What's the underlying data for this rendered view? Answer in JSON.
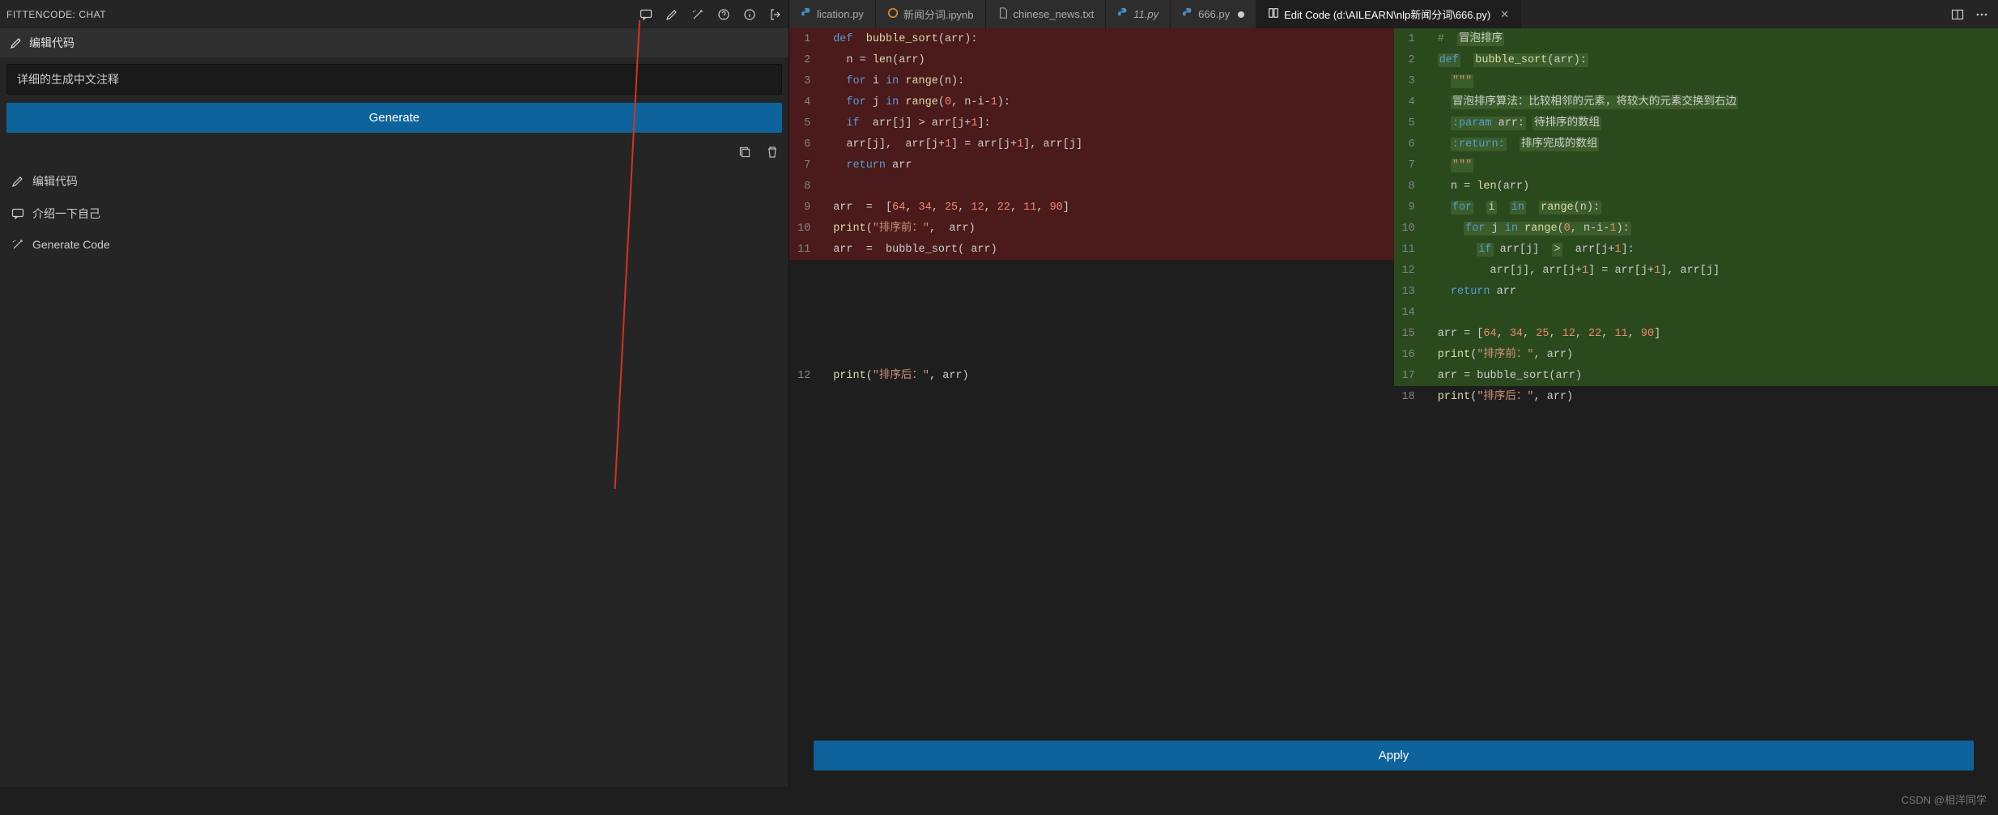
{
  "left_panel": {
    "title": "FITTENCODE: CHAT",
    "edit_header": "编辑代码",
    "input_value": "详细的生成中文注释",
    "generate_label": "Generate",
    "history": [
      {
        "icon": "pencil",
        "label": "编辑代码"
      },
      {
        "icon": "chat",
        "label": "介绍一下自己"
      },
      {
        "icon": "wand",
        "label": "Generate Code"
      }
    ]
  },
  "tabs": [
    {
      "icon": "python",
      "label": "lication.py",
      "modified": false,
      "active": false
    },
    {
      "icon": "jupyter",
      "label": "新闻分词.ipynb",
      "modified": false,
      "active": false
    },
    {
      "icon": "file",
      "label": "chinese_news.txt",
      "modified": false,
      "active": false
    },
    {
      "icon": "python",
      "label": "11.py",
      "modified": false,
      "active": false,
      "italic": true
    },
    {
      "icon": "python",
      "label": "666.py",
      "modified": true,
      "active": false
    },
    {
      "icon": "edit",
      "label": "Edit Code (d:\\AILEARN\\nlp新闻分词\\666.py)",
      "modified": false,
      "active": true,
      "closeable": true
    }
  ],
  "diff": {
    "left_lines": [
      {
        "n": 1,
        "cls": "del",
        "html": "<span class='tok-kw'>def</span>  <span class='tok-fn'>bubble_sort</span>(arr):"
      },
      {
        "n": 2,
        "cls": "del",
        "html": "  n = <span class='tok-fn'>len</span>(arr)"
      },
      {
        "n": 3,
        "cls": "del",
        "html": "  <span class='tok-kw'>for</span> i <span class='tok-kw'>in</span> <span class='tok-fn'>range</span>(n):"
      },
      {
        "n": 4,
        "cls": "del",
        "html": "  <span class='tok-kw'>for</span> j <span class='tok-kw'>in</span> <span class='tok-fn'>range</span>(<span class='tok-num-del'>0</span>, n-i-<span class='tok-num-del'>1</span>):"
      },
      {
        "n": 5,
        "cls": "del",
        "html": "  <span class='tok-kw'>if</span>  arr[j] &gt; arr[j+<span class='tok-num-del'>1</span>]:"
      },
      {
        "n": 6,
        "cls": "del",
        "html": "  arr[j],  arr[j+<span class='tok-num-del'>1</span>] = arr[j+<span class='tok-num-del'>1</span>], arr[j]"
      },
      {
        "n": 7,
        "cls": "del",
        "html": "  <span class='tok-kw'>return</span> arr"
      },
      {
        "n": 8,
        "cls": "del",
        "html": ""
      },
      {
        "n": 9,
        "cls": "del",
        "html": "arr  =  [<span class='tok-num-del'>64</span>, <span class='tok-num-del'>34</span>, <span class='tok-num-del'>25</span>, <span class='tok-num-del'>12</span>, <span class='tok-num-del'>22</span>, <span class='tok-num-del'>11</span>, <span class='tok-num-del'>90</span>]"
      },
      {
        "n": 10,
        "cls": "del",
        "html": "<span class='tok-fn'>print</span>(<span class='tok-str'>\"排序前：\"</span>,  arr)"
      },
      {
        "n": 11,
        "cls": "del",
        "html": "arr  =  bubble_sort( arr)"
      },
      {
        "n": "",
        "cls": "none",
        "html": ""
      },
      {
        "n": "",
        "cls": "none",
        "html": ""
      },
      {
        "n": "",
        "cls": "none",
        "html": ""
      },
      {
        "n": "",
        "cls": "none",
        "html": ""
      },
      {
        "n": "",
        "cls": "none",
        "html": ""
      },
      {
        "n": 12,
        "cls": "none",
        "html": "<span class='tok-fn'>print</span>(<span class='tok-str'>\"排序后：\"</span>, arr)"
      }
    ],
    "right_lines": [
      {
        "n": 1,
        "cls": "add",
        "html": "<span class='tok-comment'>#</span>  <span class='hl-green'>冒泡排序</span>"
      },
      {
        "n": 2,
        "cls": "add",
        "html": "<span class='hl-green'><span class='tok-kw'>def</span></span>  <span class='hl-green'><span class='tok-fn'>bubble_sort</span>(arr):</span>"
      },
      {
        "n": 3,
        "cls": "add",
        "html": "  <span class='hl-green'><span class='tok-str'>\"\"\"</span></span>"
      },
      {
        "n": 4,
        "cls": "add",
        "html": "  <span class='hl-green'>冒泡排序算法：比较相邻的元素，将较大的元素交换到右边</span>"
      },
      {
        "n": 5,
        "cls": "add",
        "html": "  <span class='hl-green'><span class='tok-kw'>:param</span> arr:</span> <span class='hl-green'>待排序的数组</span>"
      },
      {
        "n": 6,
        "cls": "add",
        "html": "  <span class='hl-green'><span class='tok-kw'>:return:</span></span>  <span class='hl-green'>排序完成的数组</span>"
      },
      {
        "n": 7,
        "cls": "add",
        "html": "  <span class='hl-green'><span class='tok-str'>\"\"\"</span></span>"
      },
      {
        "n": 8,
        "cls": "add",
        "html": "  n = <span class='tok-fn'>len</span>(arr)"
      },
      {
        "n": 9,
        "cls": "add",
        "html": "  <span class='hl-green'><span class='tok-kw'>for</span></span>  <span class='hl-green'>i</span>  <span class='hl-green'><span class='tok-kw'>in</span></span>  <span class='hl-green'><span class='tok-fn'>range</span>(n):</span>"
      },
      {
        "n": 10,
        "cls": "add",
        "html": "    <span class='hl-green'><span class='tok-kw'>for</span> j <span class='tok-kw'>in</span> <span class='tok-fn'>range</span>(<span class='tok-num-del'>0</span>, n-i-<span class='tok-num-del'>1</span>):</span>"
      },
      {
        "n": 11,
        "cls": "add",
        "html": "      <span class='hl-green'><span class='tok-kw'>if</span></span> arr[j]  <span class='hl-green'>&gt;</span>  arr[j+<span class='tok-num-del'>1</span>]:"
      },
      {
        "n": 12,
        "cls": "add",
        "html": "        arr[j], arr[j+<span class='tok-num-del'>1</span>] = arr[j+<span class='tok-num-del'>1</span>], arr[j]"
      },
      {
        "n": 13,
        "cls": "add",
        "html": "  <span class='tok-kw'>return</span> arr"
      },
      {
        "n": 14,
        "cls": "add",
        "html": ""
      },
      {
        "n": 15,
        "cls": "add",
        "html": "arr = [<span class='tok-num-del'>64</span>, <span class='tok-num-del'>34</span>, <span class='tok-num-del'>25</span>, <span class='tok-num-del'>12</span>, <span class='tok-num-del'>22</span>, <span class='tok-num-del'>11</span>, <span class='tok-num-del'>90</span>]"
      },
      {
        "n": 16,
        "cls": "add",
        "html": "<span class='tok-fn'>print</span>(<span class='tok-str'>\"排序前：\"</span>, arr)"
      },
      {
        "n": 17,
        "cls": "add",
        "html": "arr = bubble_sort(arr)"
      },
      {
        "n": 18,
        "cls": "none",
        "html": "<span class='tok-fn'>print</span>(<span class='tok-str'>\"排序后：\"</span>, arr)"
      }
    ]
  },
  "apply_label": "Apply",
  "footer": "CSDN @相洋同学"
}
